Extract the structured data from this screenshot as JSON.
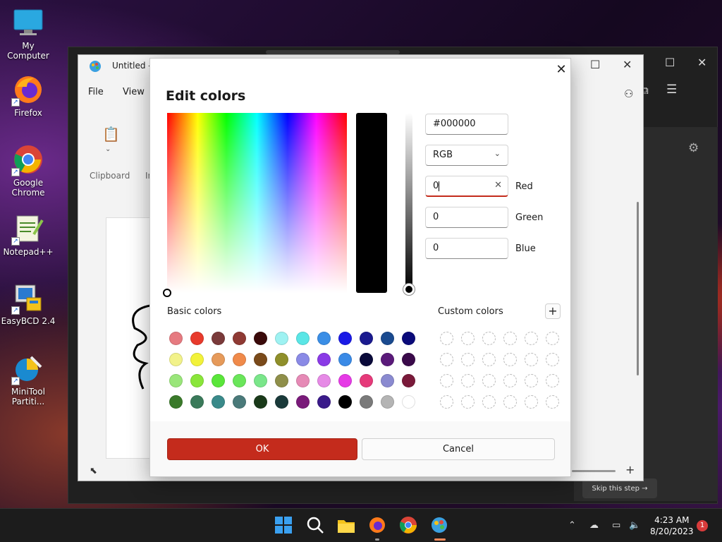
{
  "desktop": {
    "icons": [
      {
        "label": "My Computer"
      },
      {
        "label": "Firefox"
      },
      {
        "label": "Google Chrome"
      },
      {
        "label": "Notepad++"
      },
      {
        "label": "EasyBCD 2.4"
      },
      {
        "label": "MiniTool Partiti..."
      }
    ]
  },
  "background": {
    "skip_step": "Skip this step →"
  },
  "paint": {
    "title": "Untitled -",
    "menu_file": "File",
    "menu_view": "View",
    "clipboard_label": "Clipboard",
    "image_label_partial": "In"
  },
  "dialog": {
    "title": "Edit colors",
    "close_glyph": "✕",
    "hex_value": "#000000",
    "mode_value": "RGB",
    "red_value": "0",
    "red_label": "Red",
    "green_value": "0",
    "green_label": "Green",
    "blue_value": "0",
    "blue_label": "Blue",
    "clear_glyph": "✕",
    "basic_colors_label": "Basic colors",
    "custom_colors_label": "Custom colors",
    "add_custom_glyph": "+",
    "ok_label": "OK",
    "cancel_label": "Cancel",
    "preview_color": "#000000",
    "accent_color": "#c42b1c",
    "basic_colors": [
      [
        "#e67a80",
        "#e83a2c",
        "#7a3a3a",
        "#8f3a34",
        "#3a0a0a",
        "#9ef2f2",
        "#5ae6e6",
        "#3a8ee6",
        "#1a1ae6",
        "#1a1a8f",
        "#1a4a8f",
        "#0a0a7a"
      ],
      [
        "#f2f28a",
        "#f2f23a",
        "#e69a5a",
        "#f08a4a",
        "#7a4a1a",
        "#8f8f2a",
        "#8a8ae6",
        "#8a3ae6",
        "#3a8ae6",
        "#0a0a3a",
        "#5a1a7a",
        "#3a0a4a"
      ],
      [
        "#9ae67a",
        "#8ae63a",
        "#5ae63a",
        "#6ae65a",
        "#7ae68a",
        "#8f8f4a",
        "#e68ab6",
        "#e68ae6",
        "#e63ae6",
        "#e63a7a",
        "#8a8ad0",
        "#7a1a3a"
      ],
      [
        "#3a7a2a",
        "#3a7a5a",
        "#3a8a8a",
        "#4a7a7a",
        "#1a3a1a",
        "#1a3a3a",
        "#7a1a7a",
        "#3a1a8a",
        "#000000",
        "#7a7a7a",
        "#b4b4b4",
        "#ffffff"
      ]
    ]
  },
  "taskbar": {
    "time": "4:23 AM",
    "date": "8/20/2023",
    "notifications": "1"
  }
}
